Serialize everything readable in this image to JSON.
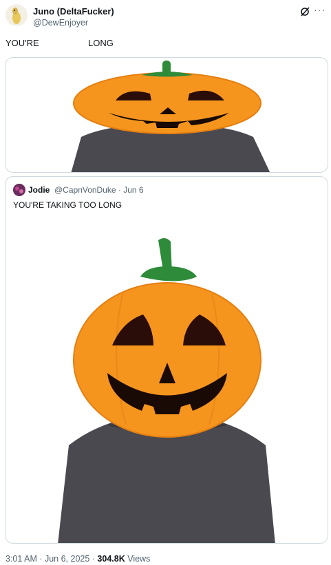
{
  "post": {
    "author_name": "Juno (DeltaFucker)",
    "author_handle": "@DewEnjoyer",
    "text_word_1": "YOU'RE",
    "text_word_2": "LONG",
    "media_1": "pumpkin-head-image-cropped"
  },
  "quote": {
    "author_name": "Jodie",
    "author_meta": "@CapnVonDuke · Jun 6",
    "text": "YOU'RE TAKING TOO LONG",
    "media": "pumpkin-head-image-full"
  },
  "footer": {
    "time_date": "3:01 AM · Jun 6, 2025 · ",
    "views_count": "304.8K",
    "views_label": " Views"
  },
  "colors": {
    "pumpkin": "#f6951e",
    "stem": "#2e8b3a",
    "shirt": "#4a4950",
    "muted": "#536471",
    "border": "#cfd9de"
  },
  "icons": [
    "grok-icon",
    "more-icon"
  ]
}
